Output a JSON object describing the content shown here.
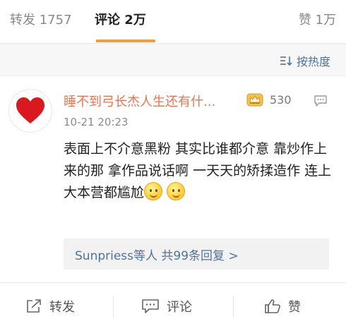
{
  "tabs": {
    "repost_label": "转发 1757",
    "comment_label": "评论 2万",
    "like_label": "赞 1万"
  },
  "sortbar": {
    "sort_label": "按热度"
  },
  "comment": {
    "username": "睡不到弓长杰人生还有什...",
    "badge_icon": "crown-badge-icon",
    "like_count": "530",
    "timestamp": "10-21 20:23",
    "text": "表面上不介意黑粉  其实比谁都介意 靠炒作上来的那 拿作品说话啊  一天天的矫揉造作  连上大本营都尴尬",
    "replies_label": "Sunpriess等人  共99条回复 >"
  },
  "actions": {
    "repost_label": "转发",
    "comment_label": "评论",
    "like_label": "赞"
  },
  "colors": {
    "accent": "#f19d38",
    "username": "#eb7350",
    "link": "#50739b",
    "heart": "#d9181f"
  }
}
